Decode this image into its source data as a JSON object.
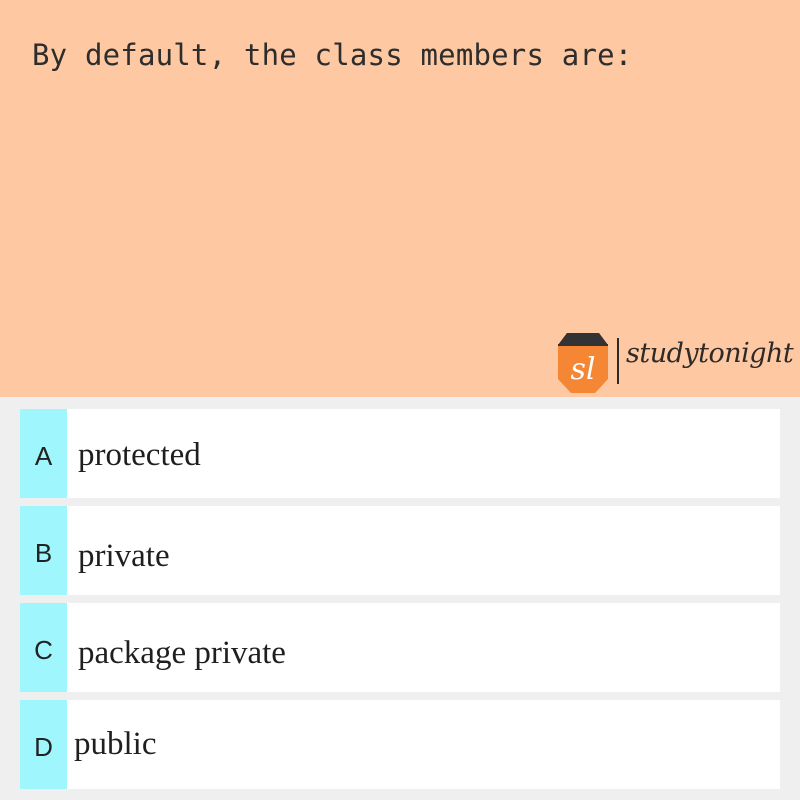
{
  "question": {
    "text": "By default, the class members are:"
  },
  "brand": {
    "logo_letters": "sl",
    "wordmark": "studytonight",
    "logo_color": "#f58634",
    "logo_dark_color": "#333333"
  },
  "options": [
    {
      "letter": "A",
      "text": "protected"
    },
    {
      "letter": "B",
      "text": "private"
    },
    {
      "letter": "C",
      "text": "package private"
    },
    {
      "letter": "D",
      "text": "public"
    }
  ],
  "colors": {
    "question_background": "#fdc8a2",
    "option_letter_background": "#9ff6fc",
    "page_background": "#efefef"
  }
}
